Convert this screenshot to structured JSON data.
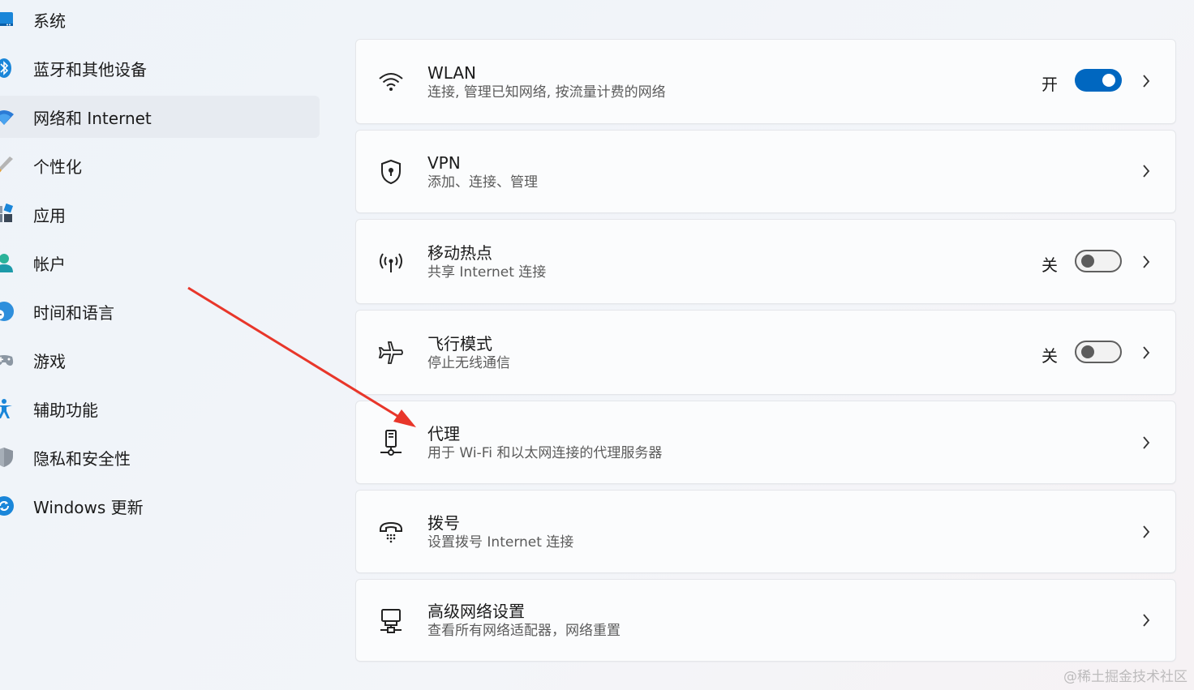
{
  "sidebar": {
    "items": [
      {
        "label": "系统",
        "icon": "system-icon"
      },
      {
        "label": "蓝牙和其他设备",
        "icon": "bluetooth-icon"
      },
      {
        "label": "网络和 Internet",
        "icon": "network-icon",
        "active": true
      },
      {
        "label": "个性化",
        "icon": "brush-icon"
      },
      {
        "label": "应用",
        "icon": "apps-icon"
      },
      {
        "label": "帐户",
        "icon": "account-icon"
      },
      {
        "label": "时间和语言",
        "icon": "globe-clock-icon"
      },
      {
        "label": "游戏",
        "icon": "gamepad-icon"
      },
      {
        "label": "辅助功能",
        "icon": "accessibility-icon"
      },
      {
        "label": "隐私和安全性",
        "icon": "shield-icon"
      },
      {
        "label": "Windows 更新",
        "icon": "update-icon"
      }
    ]
  },
  "cards": [
    {
      "title": "WLAN",
      "subtitle": "连接, 管理已知网络, 按流量计费的网络",
      "icon": "wifi-icon",
      "toggle": "on",
      "state_label": "开"
    },
    {
      "title": "VPN",
      "subtitle": "添加、连接、管理",
      "icon": "vpn-shield-icon"
    },
    {
      "title": "移动热点",
      "subtitle": "共享 Internet 连接",
      "icon": "hotspot-icon",
      "toggle": "off",
      "state_label": "关"
    },
    {
      "title": "飞行模式",
      "subtitle": "停止无线通信",
      "icon": "airplane-icon",
      "toggle": "off",
      "state_label": "关"
    },
    {
      "title": "代理",
      "subtitle": "用于 Wi-Fi 和以太网连接的代理服务器",
      "icon": "proxy-icon"
    },
    {
      "title": "拨号",
      "subtitle": "设置拨号 Internet 连接",
      "icon": "dialup-icon"
    },
    {
      "title": "高级网络设置",
      "subtitle": "查看所有网络适配器，网络重置",
      "icon": "advanced-network-icon"
    }
  ],
  "watermark": "@稀土掘金技术社区",
  "colors": {
    "accent": "#0067c0",
    "annotation_arrow": "#e8362a"
  }
}
